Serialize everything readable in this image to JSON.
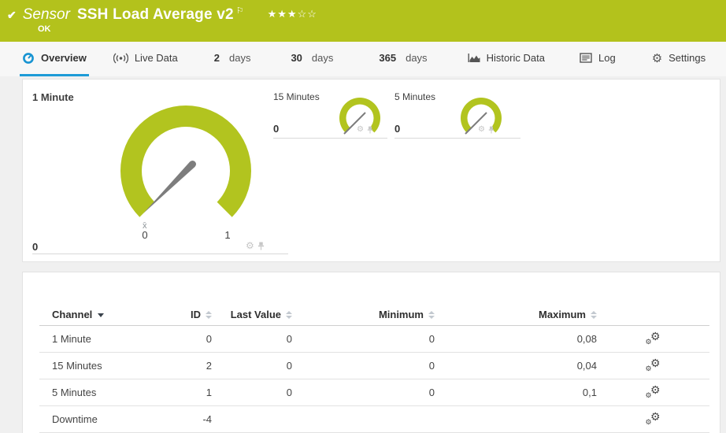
{
  "header": {
    "check_icon": "✔",
    "kind_label": "Sensor",
    "title": "SSH Load Average v2",
    "flag_icon": "⚐",
    "stars_filled": "★★★",
    "stars_empty": "☆☆",
    "status": "OK",
    "status_color": "#b3c21c"
  },
  "tabs": {
    "overview": "Overview",
    "live_data": "Live Data",
    "d2_num": "2",
    "d2_label": "days",
    "d30_num": "30",
    "d30_label": "days",
    "d365_num": "365",
    "d365_label": "days",
    "historic": "Historic Data",
    "log": "Log",
    "settings": "Settings",
    "active_tab": "Overview",
    "accent_color": "#1e9bd7"
  },
  "icons": {
    "gear_glyph": "⚙"
  },
  "gauges": {
    "arc_color": "#b2c41f",
    "needle_color": "#7d7d7d",
    "primary": {
      "title": "1 Minute",
      "value": "0",
      "tick_min": "0",
      "tick_max": "1",
      "avg_marker": "x̄"
    },
    "secondary": [
      {
        "title": "15 Minutes",
        "value": "0"
      },
      {
        "title": "5 Minutes",
        "value": "0"
      }
    ]
  },
  "table": {
    "columns": {
      "channel": "Channel",
      "id": "ID",
      "last_value": "Last Value",
      "minimum": "Minimum",
      "maximum": "Maximum"
    },
    "rows": [
      {
        "channel": "1 Minute",
        "id": "0",
        "last_value": "0",
        "minimum": "0",
        "maximum": "0,08"
      },
      {
        "channel": "15 Minutes",
        "id": "2",
        "last_value": "0",
        "minimum": "0",
        "maximum": "0,04"
      },
      {
        "channel": "5 Minutes",
        "id": "1",
        "last_value": "0",
        "minimum": "0",
        "maximum": "0,1"
      },
      {
        "channel": "Downtime",
        "id": "-4",
        "last_value": "",
        "minimum": "",
        "maximum": ""
      }
    ]
  }
}
